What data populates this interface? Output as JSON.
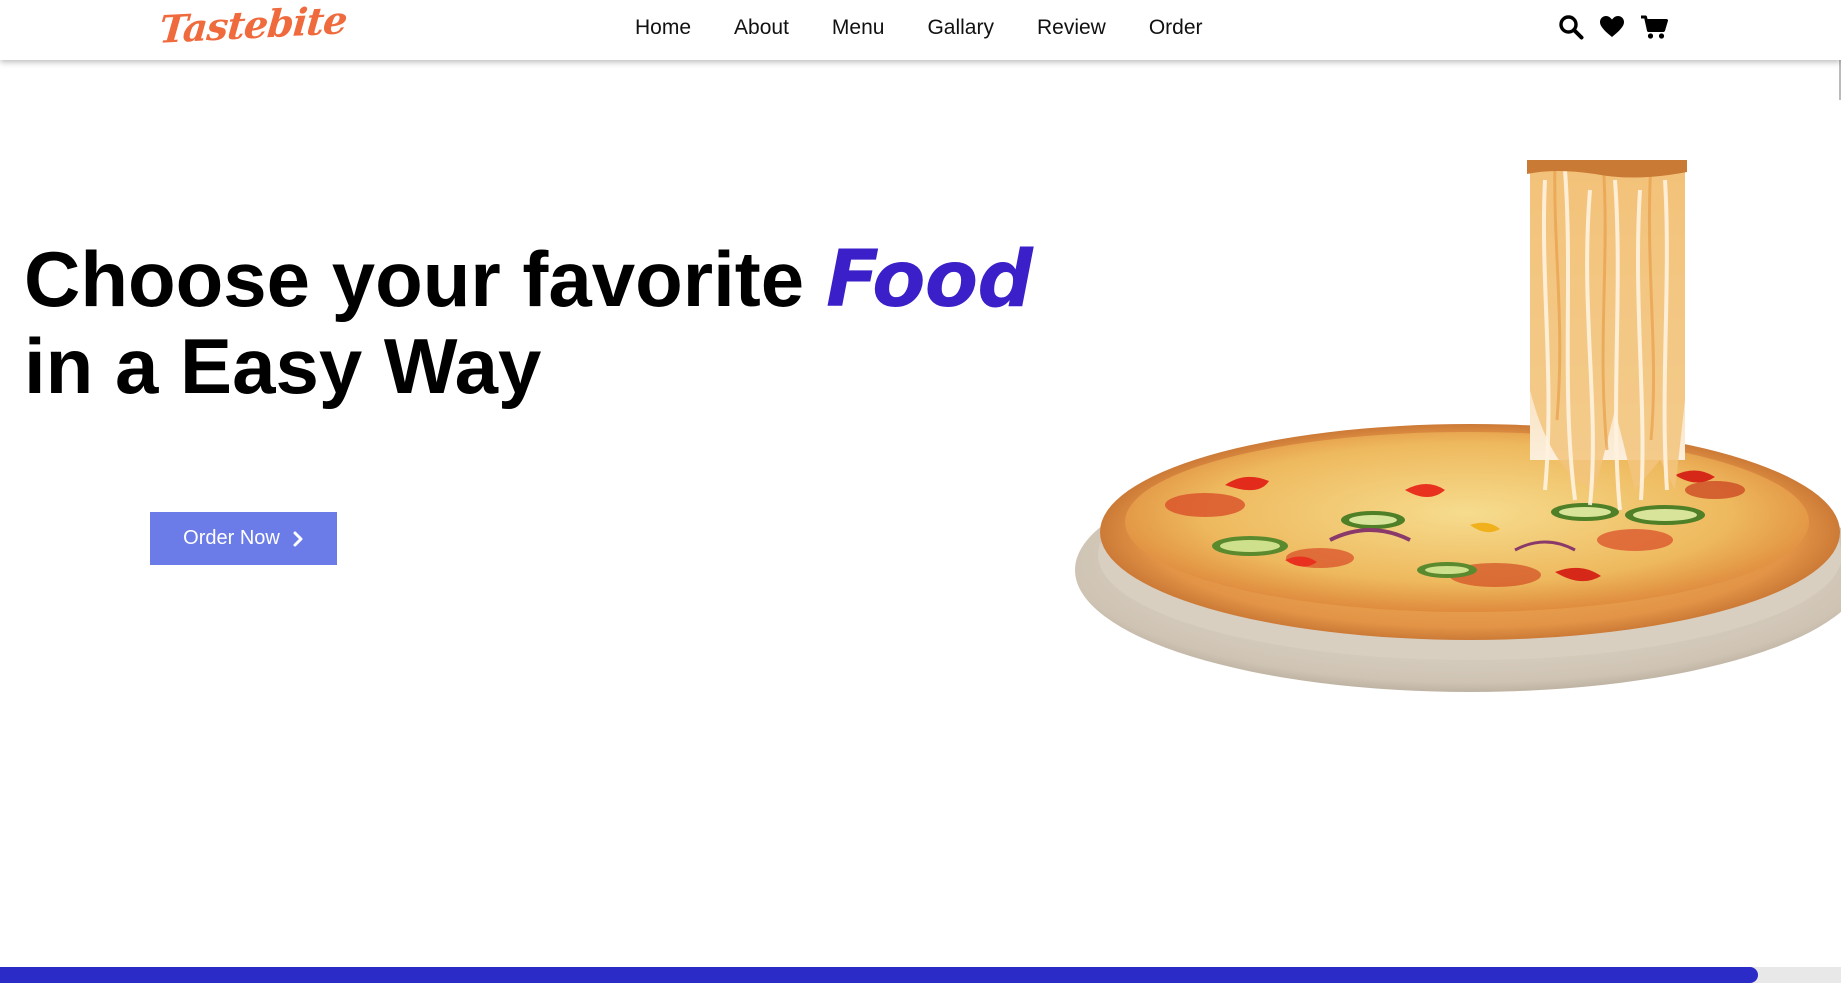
{
  "brand": {
    "logo_text": "Tastebite",
    "accent_color": "#3b20c9",
    "logo_color": "#ef6a3c"
  },
  "nav": {
    "links": [
      "Home",
      "About",
      "Menu",
      "Gallary",
      "Review",
      "Order"
    ],
    "icons": [
      "search-icon",
      "heart-icon",
      "cart-icon"
    ]
  },
  "hero": {
    "title_line1": "Choose your favorite ",
    "title_accent": "Food",
    "title_line2": "in a Easy Way",
    "cta_label": "Order Now",
    "button_color": "#6b7be8"
  },
  "scroll_progress": 0.955
}
